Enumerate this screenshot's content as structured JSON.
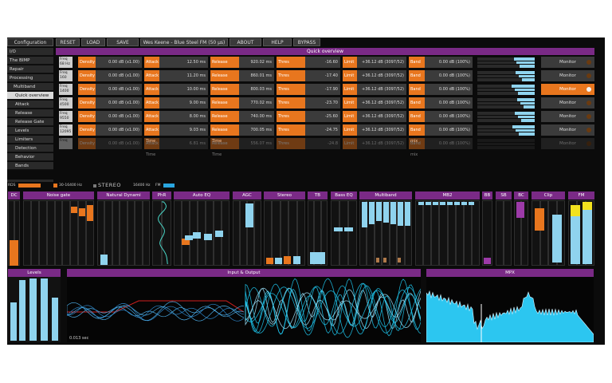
{
  "menu": {
    "reset": "RESET",
    "load": "LOAD",
    "save": "SAVE",
    "preset": "Wes Keene - Blue Steel FM (50 µs)",
    "about": "ABOUT",
    "help": "HELP",
    "bypass": "BYPASS"
  },
  "sidebar": [
    {
      "label": "Configuration",
      "level": 0,
      "selected": false
    },
    {
      "label": "I/O",
      "level": 0,
      "selected": false
    },
    {
      "label": "The BIMP",
      "level": 0,
      "selected": false
    },
    {
      "label": "Repair",
      "level": 0,
      "selected": false
    },
    {
      "label": "Processing",
      "level": 0,
      "selected": false
    },
    {
      "label": "Multiband",
      "level": 1,
      "selected": false
    },
    {
      "label": "Quick overview",
      "level": 2,
      "selected": true
    },
    {
      "label": "Attack",
      "level": 2,
      "selected": false
    },
    {
      "label": "Release",
      "level": 2,
      "selected": false
    },
    {
      "label": "Release Gate",
      "level": 2,
      "selected": false
    },
    {
      "label": "Levels",
      "level": 2,
      "selected": false
    },
    {
      "label": "Limiters",
      "level": 2,
      "selected": false
    },
    {
      "label": "Detection",
      "level": 2,
      "selected": false
    },
    {
      "label": "Behavior",
      "level": 2,
      "selected": false
    },
    {
      "label": "Bands",
      "level": 2,
      "selected": false
    }
  ],
  "quick_overview": {
    "title": "Quick overview",
    "labels": {
      "density": "Density",
      "attack": "Attack Time",
      "release": "Release Time",
      "thres": "Thres",
      "limit": "Limit",
      "bandmix": "Band mix",
      "monitor": "Monitor"
    },
    "rows": [
      {
        "freq": "Freq",
        "hz": "68 Hz",
        "density": "0.00 dB (x1.00)",
        "attack": "12.50 ms",
        "release": "920.02 ms",
        "thres": "-16.60",
        "limit": "+36.12 dB (3097/52)",
        "bandmix": "0.00 dB (100%)",
        "level": 0.55,
        "monitor_on": false
      },
      {
        "freq": "Freq",
        "hz": "160",
        "density": "0.00 dB (x1.00)",
        "attack": "11.20 ms",
        "release": "860.01 ms",
        "thres": "-17.40",
        "limit": "+36.12 dB (3097/52)",
        "bandmix": "0.00 dB (100%)",
        "level": 0.5,
        "monitor_on": false
      },
      {
        "freq": "Freq",
        "hz": "1400",
        "density": "0.00 dB (x1.00)",
        "attack": "10.00 ms",
        "release": "800.03 ms",
        "thres": "-17.90",
        "limit": "+36.12 dB (3097/52)",
        "bandmix": "0.00 dB (100%)",
        "level": 0.6,
        "monitor_on": true
      },
      {
        "freq": "Freq",
        "hz": "4500",
        "density": "0.00 dB (x1.00)",
        "attack": "9.00 ms",
        "release": "770.02 ms",
        "thres": "-23.70",
        "limit": "+36.12 dB (3097/52)",
        "bandmix": "0.00 dB (100%)",
        "level": 0.45,
        "monitor_on": false
      },
      {
        "freq": "Freq",
        "hz": "9550",
        "density": "0.00 dB (x1.00)",
        "attack": "8.00 ms",
        "release": "740.00 ms",
        "thres": "-25.60",
        "limit": "+36.12 dB (3097/52)",
        "bandmix": "0.00 dB (100%)",
        "level": 0.52,
        "monitor_on": false
      },
      {
        "freq": "Freq",
        "hz": "12095",
        "density": "0.00 dB (x1.00)",
        "attack": "9.03 ms",
        "release": "700.05 ms",
        "thres": "-24.75",
        "limit": "+36.12 dB (3097/52)",
        "bandmix": "0.00 dB (100%)",
        "level": 0.58,
        "monitor_on": false
      },
      {
        "freq": "Freq",
        "hz": "",
        "density": "0.00 dB (x1.00)",
        "attack": "6.81 ms",
        "release": "556.07 ms",
        "thres": "-24.8",
        "limit": "+36.12 dB (3097/52)",
        "bandmix": "0.00 dB (100%)",
        "level": 0,
        "monitor_on": false
      }
    ]
  },
  "status": {
    "rds": "RDS",
    "range": "30-16400 Hz",
    "stereo": "STEREO",
    "hz16400": "16400 Hz",
    "fm": "FM"
  },
  "meters": [
    "DC",
    "Noise gate",
    "Natural Dynami",
    "PhR",
    "Auto EQ",
    "AGC",
    "Stereo",
    "TB",
    "Bass EQ",
    "Multiband",
    "MB2",
    "BB",
    "SB",
    "BC",
    "Clip",
    "FM"
  ],
  "bottom": {
    "levels": "Levels",
    "io": "Input & Output",
    "mpx": "MPX",
    "time": "0.013 sec"
  },
  "colors": {
    "accent": "#e8761e",
    "header": "#7a2a86",
    "meter": "#8fd3ee",
    "wave": "#1ec8f0"
  }
}
